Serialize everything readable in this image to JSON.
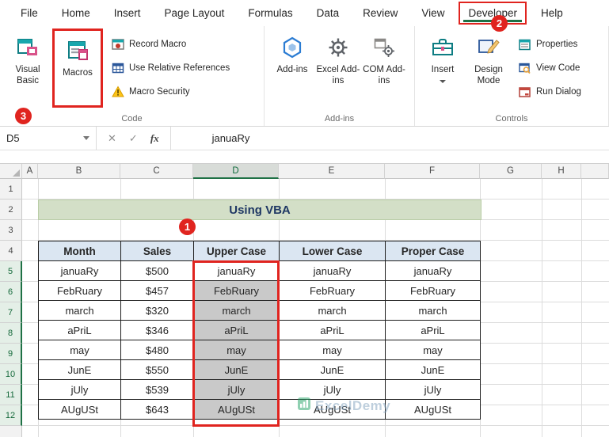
{
  "tabs": [
    "File",
    "Home",
    "Insert",
    "Page Layout",
    "Formulas",
    "Data",
    "Review",
    "View",
    "Developer",
    "Help"
  ],
  "ribbon": {
    "code": {
      "label": "Code",
      "visual_basic": "Visual Basic",
      "macros": "Macros",
      "record_macro": "Record Macro",
      "use_relative_references": "Use Relative References",
      "macro_security": "Macro Security"
    },
    "addins": {
      "label": "Add-ins",
      "addins": "Add-ins",
      "excel_addins": "Excel Add-ins",
      "com_addins": "COM Add-ins"
    },
    "controls": {
      "label": "Controls",
      "insert": "Insert",
      "design_mode": "Design Mode",
      "properties": "Properties",
      "view_code": "View Code",
      "run_dialog": "Run Dialog"
    }
  },
  "annotations": {
    "step1": "1",
    "step2": "2",
    "step3": "3"
  },
  "formula_bar": {
    "name_box": "D5",
    "cancel": "✕",
    "enter": "✓",
    "fx": "fx",
    "formula": "januaRy"
  },
  "sheet": {
    "columns": [
      "A",
      "B",
      "C",
      "D",
      "E",
      "F",
      "G",
      "H"
    ],
    "rows": [
      "1",
      "2",
      "3",
      "4",
      "5",
      "6",
      "7",
      "8",
      "9",
      "10",
      "11",
      "12"
    ],
    "title": "Using VBA",
    "table": {
      "headers": [
        "Month",
        "Sales",
        "Upper Case",
        "Lower Case",
        "Proper Case"
      ],
      "data": [
        [
          "januaRy",
          "$500",
          "januaRy",
          "januaRy",
          "januaRy"
        ],
        [
          "FebRuary",
          "$457",
          "FebRuary",
          "FebRuary",
          "FebRuary"
        ],
        [
          "march",
          "$320",
          "march",
          "march",
          "march"
        ],
        [
          "aPriL",
          "$346",
          "aPriL",
          "aPriL",
          "aPriL"
        ],
        [
          "may",
          "$480",
          "may",
          "may",
          "may"
        ],
        [
          "JunE",
          "$550",
          "JunE",
          "JunE",
          "JunE"
        ],
        [
          "jUly",
          "$539",
          "jUly",
          "jUly",
          "jUly"
        ],
        [
          "AUgUSt",
          "$643",
          "AUgUSt",
          "AUgUSt",
          "AUgUSt"
        ]
      ]
    },
    "watermark": "ExcelDemy"
  }
}
